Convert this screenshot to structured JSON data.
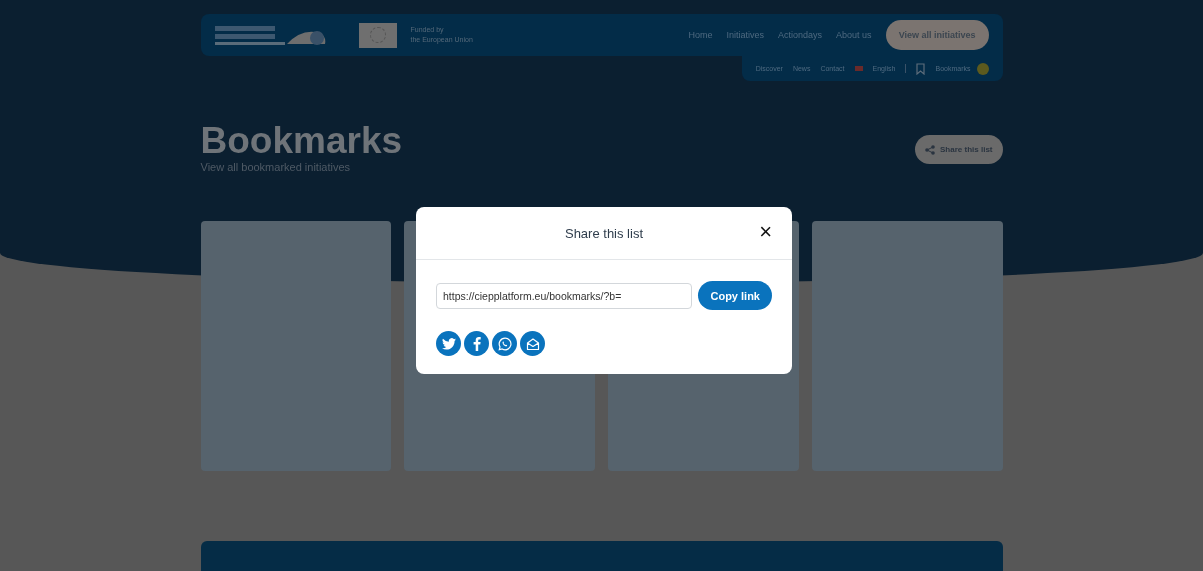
{
  "header": {
    "funding": [
      "Funded by",
      "the European Union"
    ],
    "nav": [
      "Home",
      "Initiatives",
      "Actiondays",
      "About us"
    ],
    "cta": "View all initiatives",
    "subnav": [
      "Discover",
      "News",
      "Contact"
    ],
    "language": "English",
    "bookmarks": "Bookmarks"
  },
  "page": {
    "title": "Bookmarks",
    "subtitle": "View all bookmarked initiatives",
    "share_button": "Share this list"
  },
  "modal": {
    "title": "Share this list",
    "close": "×",
    "link": "https://ciepplatform.eu/bookmarks/?b=",
    "copy_button": "Copy link",
    "share_icons": [
      {
        "kind": "twitter"
      },
      {
        "kind": "facebook"
      },
      {
        "kind": "whatsapp"
      },
      {
        "kind": "email"
      }
    ]
  }
}
